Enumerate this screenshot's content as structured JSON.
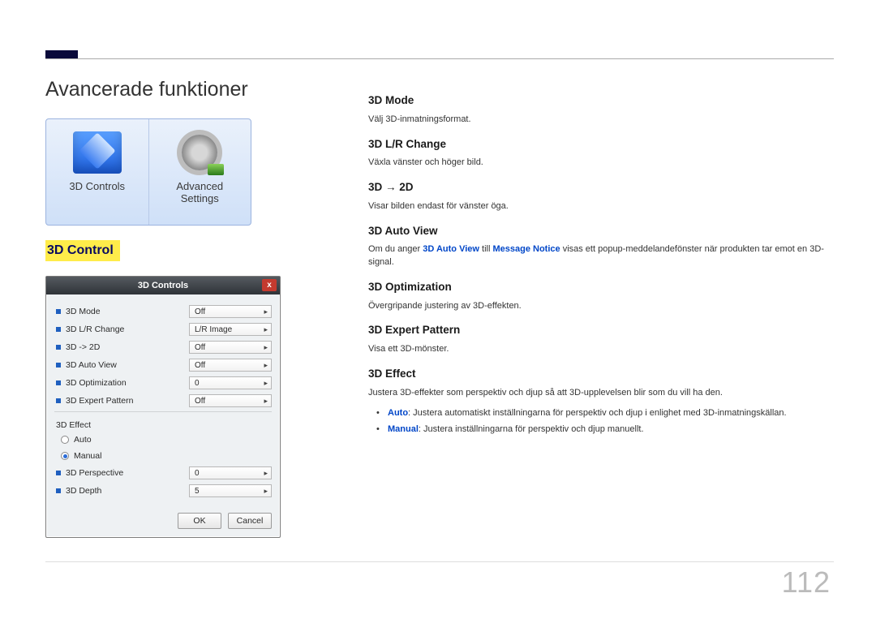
{
  "page": {
    "title": "Avancerade funktioner",
    "page_number": "112"
  },
  "left": {
    "tile1_label": "3D Controls",
    "tile2_line1": "Advanced",
    "tile2_line2": "Settings",
    "section_heading": "3D Control"
  },
  "dialog": {
    "title": "3D Controls",
    "close": "x",
    "rows": [
      {
        "label": "3D Mode",
        "value": "Off"
      },
      {
        "label": "3D L/R Change",
        "value": "L/R Image"
      },
      {
        "label": "3D -> 2D",
        "value": "Off"
      },
      {
        "label": "3D Auto View",
        "value": "Off"
      },
      {
        "label": "3D Optimization",
        "value": "0"
      },
      {
        "label": "3D Expert Pattern",
        "value": "Off"
      }
    ],
    "effect_group_label": "3D Effect",
    "radio_auto": "Auto",
    "radio_manual": "Manual",
    "sub_rows": [
      {
        "label": "3D Perspective",
        "value": "0"
      },
      {
        "label": "3D Depth",
        "value": "5"
      }
    ],
    "ok": "OK",
    "cancel": "Cancel"
  },
  "right": {
    "s1_h": "3D Mode",
    "s1_d": "Välj 3D-inmatningsformat.",
    "s2_h": "3D L/R Change",
    "s2_d": "Växla vänster och höger bild.",
    "s3_h": "3D → 2D",
    "s3_d": "Visar bilden endast för vänster öga.",
    "s4_h": "3D Auto View",
    "s4_d_pre": "Om du anger ",
    "s4_d_b1": "3D Auto View",
    "s4_d_mid": " till ",
    "s4_d_b2": "Message Notice",
    "s4_d_post": " visas ett popup-meddelandefönster när produkten tar emot en 3D-signal.",
    "s5_h": "3D Optimization",
    "s5_d": "Övergripande justering av 3D-effekten.",
    "s6_h": "3D Expert Pattern",
    "s6_d": "Visa ett 3D-mönster.",
    "s7_h": "3D Effect",
    "s7_d": "Justera 3D-effekter som perspektiv och djup så att 3D-upplevelsen blir som du vill ha den.",
    "s7_li1_b": "Auto",
    "s7_li1_t": ": Justera automatiskt inställningarna för perspektiv och djup i enlighet med 3D-inmatningskällan.",
    "s7_li2_b": "Manual",
    "s7_li2_t": ": Justera inställningarna för perspektiv och djup manuellt."
  }
}
